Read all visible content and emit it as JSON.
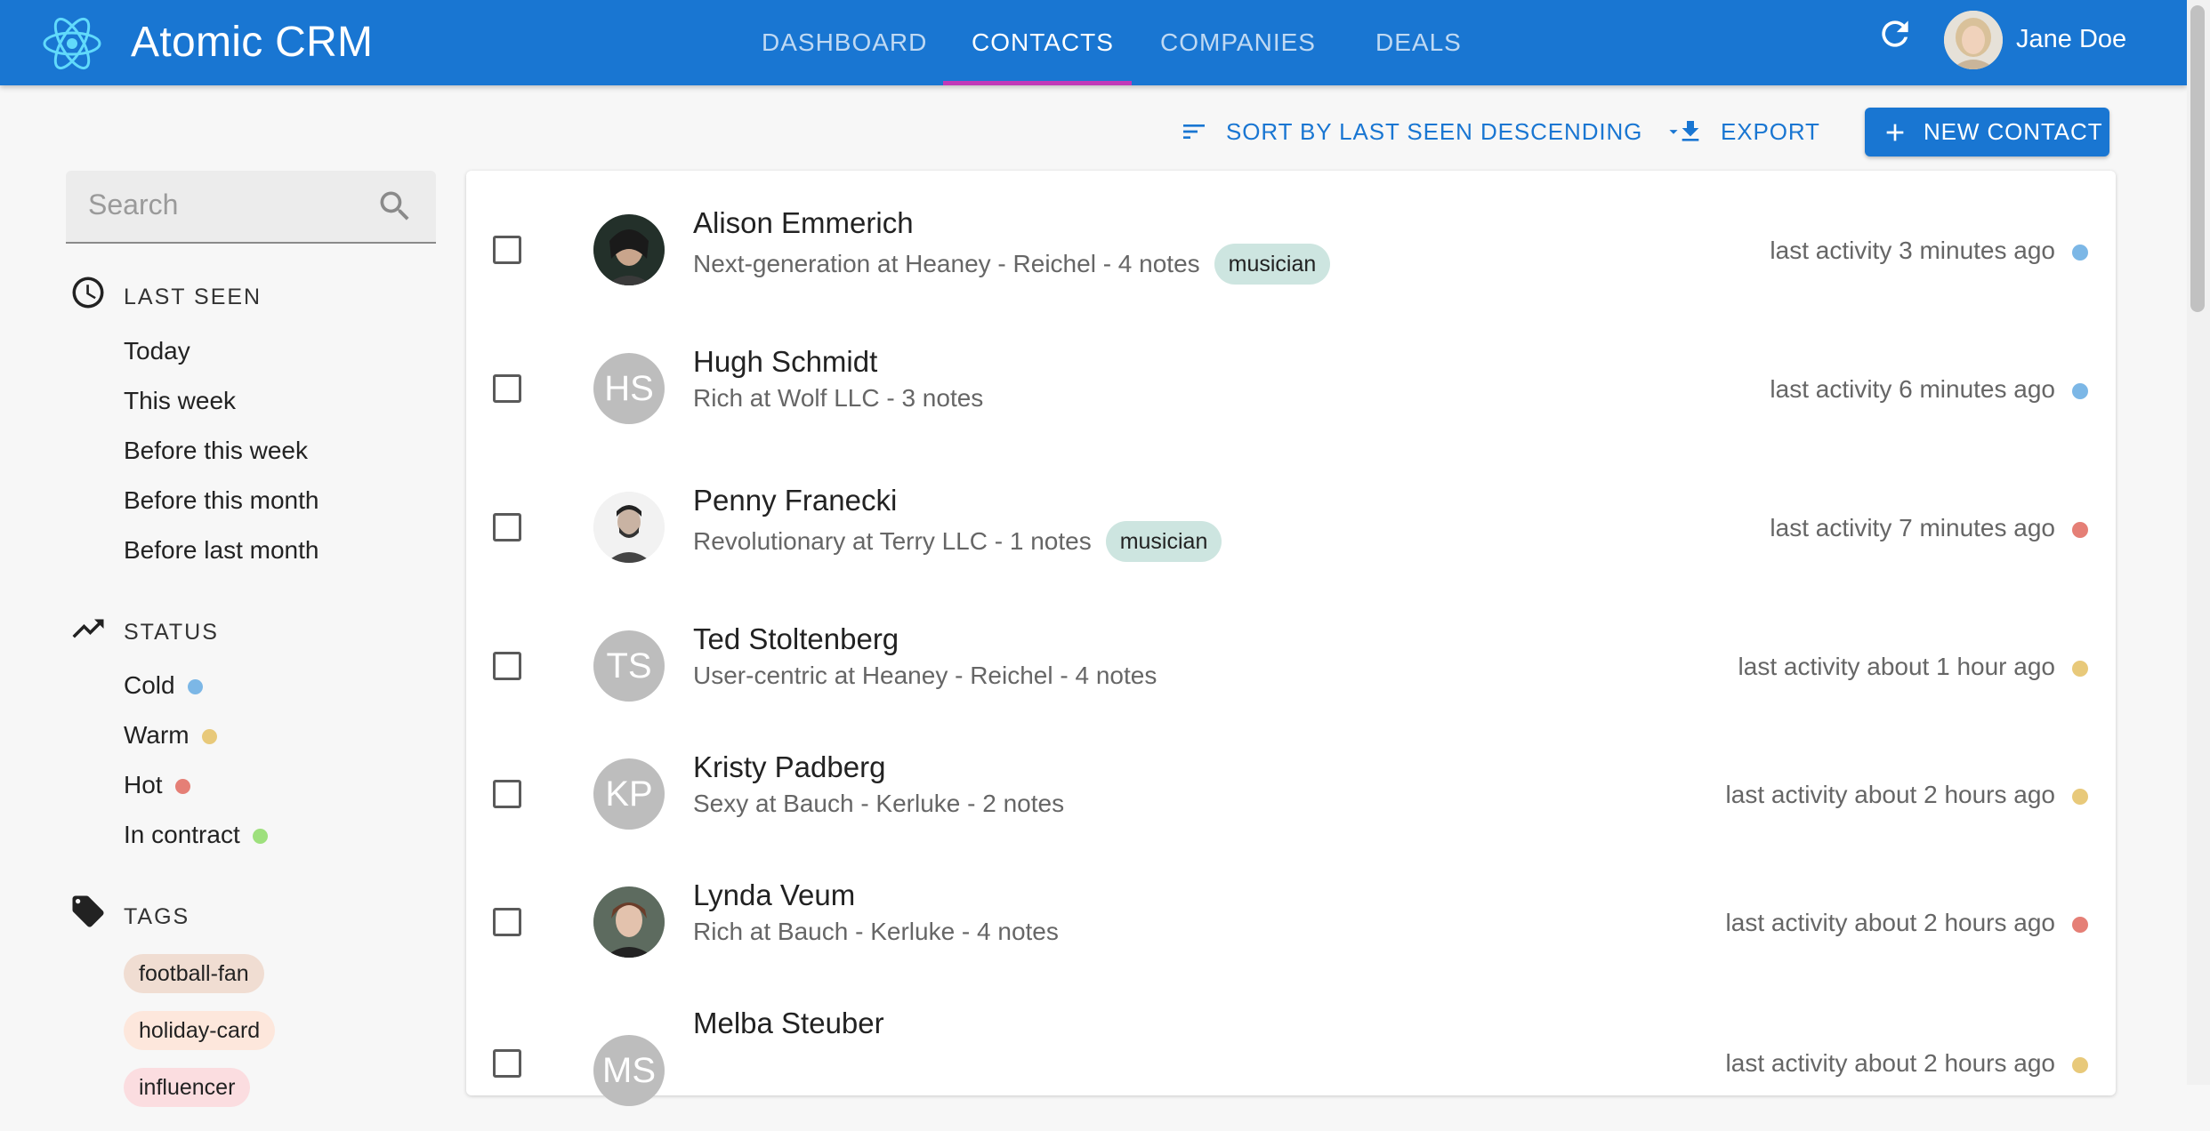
{
  "app": {
    "title": "Atomic CRM"
  },
  "nav": {
    "tabs": [
      {
        "label": "DASHBOARD"
      },
      {
        "label": "CONTACTS"
      },
      {
        "label": "COMPANIES"
      },
      {
        "label": "DEALS"
      }
    ],
    "active_tab": "CONTACTS"
  },
  "user": {
    "name": "Jane Doe"
  },
  "toolbar": {
    "sort_label": "SORT BY LAST SEEN DESCENDING",
    "export_label": "EXPORT",
    "new_contact_label": "NEW CONTACT"
  },
  "search": {
    "placeholder": "Search"
  },
  "filters": {
    "last_seen": {
      "title": "LAST SEEN",
      "items": [
        "Today",
        "This week",
        "Before this week",
        "Before this month",
        "Before last month"
      ]
    },
    "status": {
      "title": "STATUS",
      "items": [
        {
          "label": "Cold",
          "color": "#7cb7e6"
        },
        {
          "label": "Warm",
          "color": "#e8c97a"
        },
        {
          "label": "Hot",
          "color": "#e57f76"
        },
        {
          "label": "In contract",
          "color": "#9ee07d"
        }
      ]
    },
    "tags": {
      "title": "TAGS",
      "items": [
        {
          "label": "football-fan",
          "color": "#f0ddd2"
        },
        {
          "label": "holiday-card",
          "color": "#fde7dc"
        },
        {
          "label": "influencer",
          "color": "#fbdde0"
        }
      ]
    }
  },
  "contacts": [
    {
      "name": "Alison Emmerich",
      "subtitle": "Next-generation at Heaney - Reichel - 4 notes",
      "tag": "musician",
      "tag_color": "#cde5e0",
      "activity": "last activity 3 minutes ago",
      "status_color": "#7cb7e6",
      "initials": ""
    },
    {
      "name": "Hugh Schmidt",
      "subtitle": "Rich at Wolf LLC - 3 notes",
      "tag": "",
      "tag_color": "",
      "activity": "last activity 6 minutes ago",
      "status_color": "#7cb7e6",
      "initials": "HS"
    },
    {
      "name": "Penny Franecki",
      "subtitle": "Revolutionary at Terry LLC - 1 notes",
      "tag": "musician",
      "tag_color": "#cde5e0",
      "activity": "last activity 7 minutes ago",
      "status_color": "#e57f76",
      "initials": ""
    },
    {
      "name": "Ted Stoltenberg",
      "subtitle": "User-centric at Heaney - Reichel - 4 notes",
      "tag": "",
      "tag_color": "",
      "activity": "last activity about 1 hour ago",
      "status_color": "#e8c97a",
      "initials": "TS"
    },
    {
      "name": "Kristy Padberg",
      "subtitle": "Sexy at Bauch - Kerluke - 2 notes",
      "tag": "",
      "tag_color": "",
      "activity": "last activity about 2 hours ago",
      "status_color": "#e8c97a",
      "initials": "KP"
    },
    {
      "name": "Lynda Veum",
      "subtitle": "Rich at Bauch - Kerluke - 4 notes",
      "tag": "",
      "tag_color": "",
      "activity": "last activity about 2 hours ago",
      "status_color": "#e57f76",
      "initials": ""
    },
    {
      "name": "Melba Steuber",
      "subtitle": "",
      "tag": "",
      "tag_color": "",
      "activity": "last activity about 2 hours ago",
      "status_color": "#e8c97a",
      "initials": "MS"
    }
  ]
}
